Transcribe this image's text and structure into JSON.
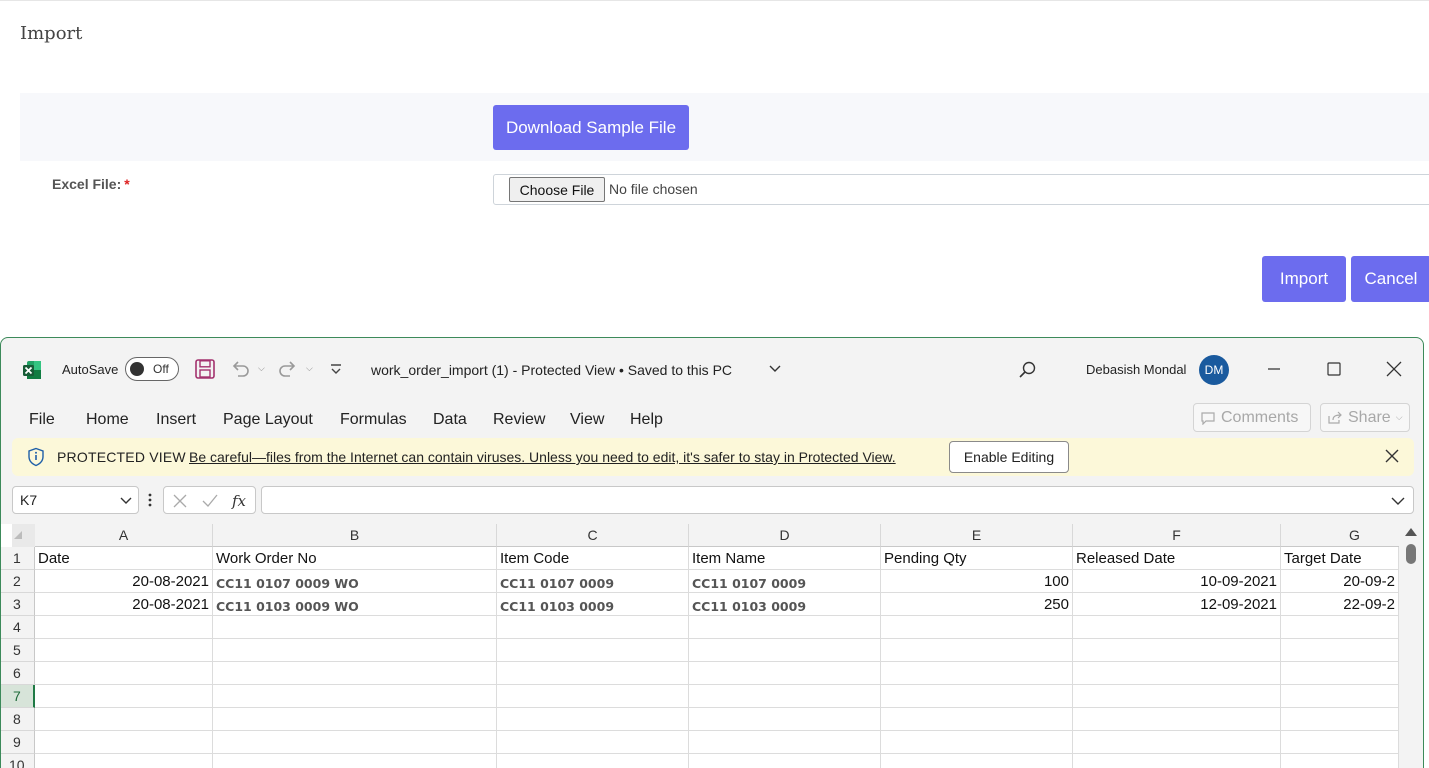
{
  "web": {
    "title": "Import",
    "download_button": "Download Sample File",
    "excel_label": "Excel File:",
    "required_mark": "*",
    "choose_file_button": "Choose File",
    "no_file_text": "No file chosen",
    "import_button": "Import",
    "cancel_button": "Cancel",
    "accent_color": "#6c6cee"
  },
  "excel": {
    "autosave_label": "AutoSave",
    "autosave_state": "Off",
    "document_title": "work_order_import (1)  -  Protected View • Saved to this PC",
    "user_name": "Debasish Mondal",
    "user_initials": "DM",
    "ribbon_tabs": [
      "File",
      "Home",
      "Insert",
      "Page Layout",
      "Formulas",
      "Data",
      "Review",
      "View",
      "Help"
    ],
    "comments_button": "Comments",
    "share_button": "Share",
    "protected_view": {
      "title": "PROTECTED VIEW",
      "message": "Be careful—files from the Internet can contain viruses. Unless you need to edit, it's safer to stay in Protected View.",
      "enable_button": "Enable Editing"
    },
    "name_box": "K7",
    "fx_label": "fx",
    "columns": [
      "A",
      "B",
      "C",
      "D",
      "E",
      "F",
      "G"
    ],
    "row_numbers": [
      "1",
      "2",
      "3",
      "4",
      "5",
      "6",
      "7",
      "8",
      "9",
      "10"
    ],
    "active_row": "7",
    "headers": [
      "Date",
      "Work Order No",
      "Item Code",
      "Item Name",
      "Pending Qty",
      "Released Date",
      "Target Date"
    ],
    "rows": [
      [
        "20-08-2021",
        "CC11 0107 0009 WO",
        "CC11 0107 0009",
        "CC11 0107 0009",
        "100",
        "10-09-2021",
        "20-09-2"
      ],
      [
        "20-08-2021",
        "CC11 0103 0009 WO",
        "CC11 0103 0009",
        "CC11 0103 0009",
        "250",
        "12-09-2021",
        "22-09-2"
      ]
    ]
  }
}
